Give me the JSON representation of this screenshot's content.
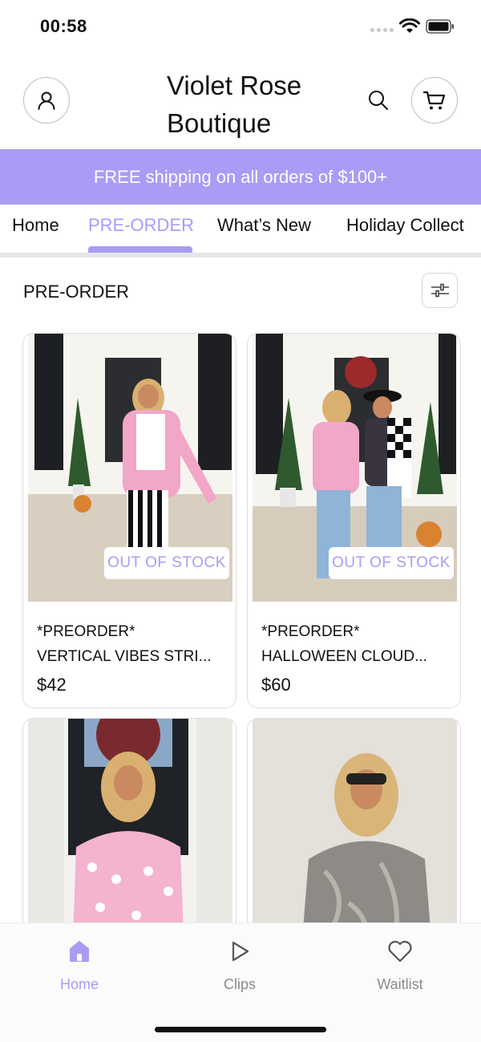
{
  "status_bar": {
    "time": "00:58"
  },
  "header": {
    "store_title": "Violet Rose Boutique"
  },
  "banner": {
    "text": "FREE shipping on all orders of $100+"
  },
  "tabs": [
    {
      "label": "Home",
      "active": false
    },
    {
      "label": "PRE-ORDER",
      "active": true
    },
    {
      "label": "What’s New",
      "active": false
    },
    {
      "label": "Holiday Collect",
      "active": false
    }
  ],
  "section": {
    "title": "PRE-ORDER"
  },
  "products": [
    {
      "line1": "*PREORDER*",
      "line2": "VERTICAL VIBES STRI...",
      "price": "$42",
      "badge": "OUT OF STOCK"
    },
    {
      "line1": "*PREORDER*",
      "line2": "HALLOWEEN CLOUD...",
      "price": "$60",
      "badge": "OUT OF STOCK"
    },
    {
      "line1": "",
      "line2": "",
      "price": "",
      "badge": ""
    },
    {
      "line1": "",
      "line2": "",
      "price": "",
      "badge": ""
    }
  ],
  "bottom_nav": [
    {
      "label": "Home",
      "icon": "home-icon",
      "active": true
    },
    {
      "label": "Clips",
      "icon": "play-icon",
      "active": false
    },
    {
      "label": "Waitlist",
      "icon": "heart-icon",
      "active": false
    }
  ],
  "colors": {
    "accent": "#a99cf4",
    "text": "#111111",
    "muted": "#8b8b8b"
  }
}
